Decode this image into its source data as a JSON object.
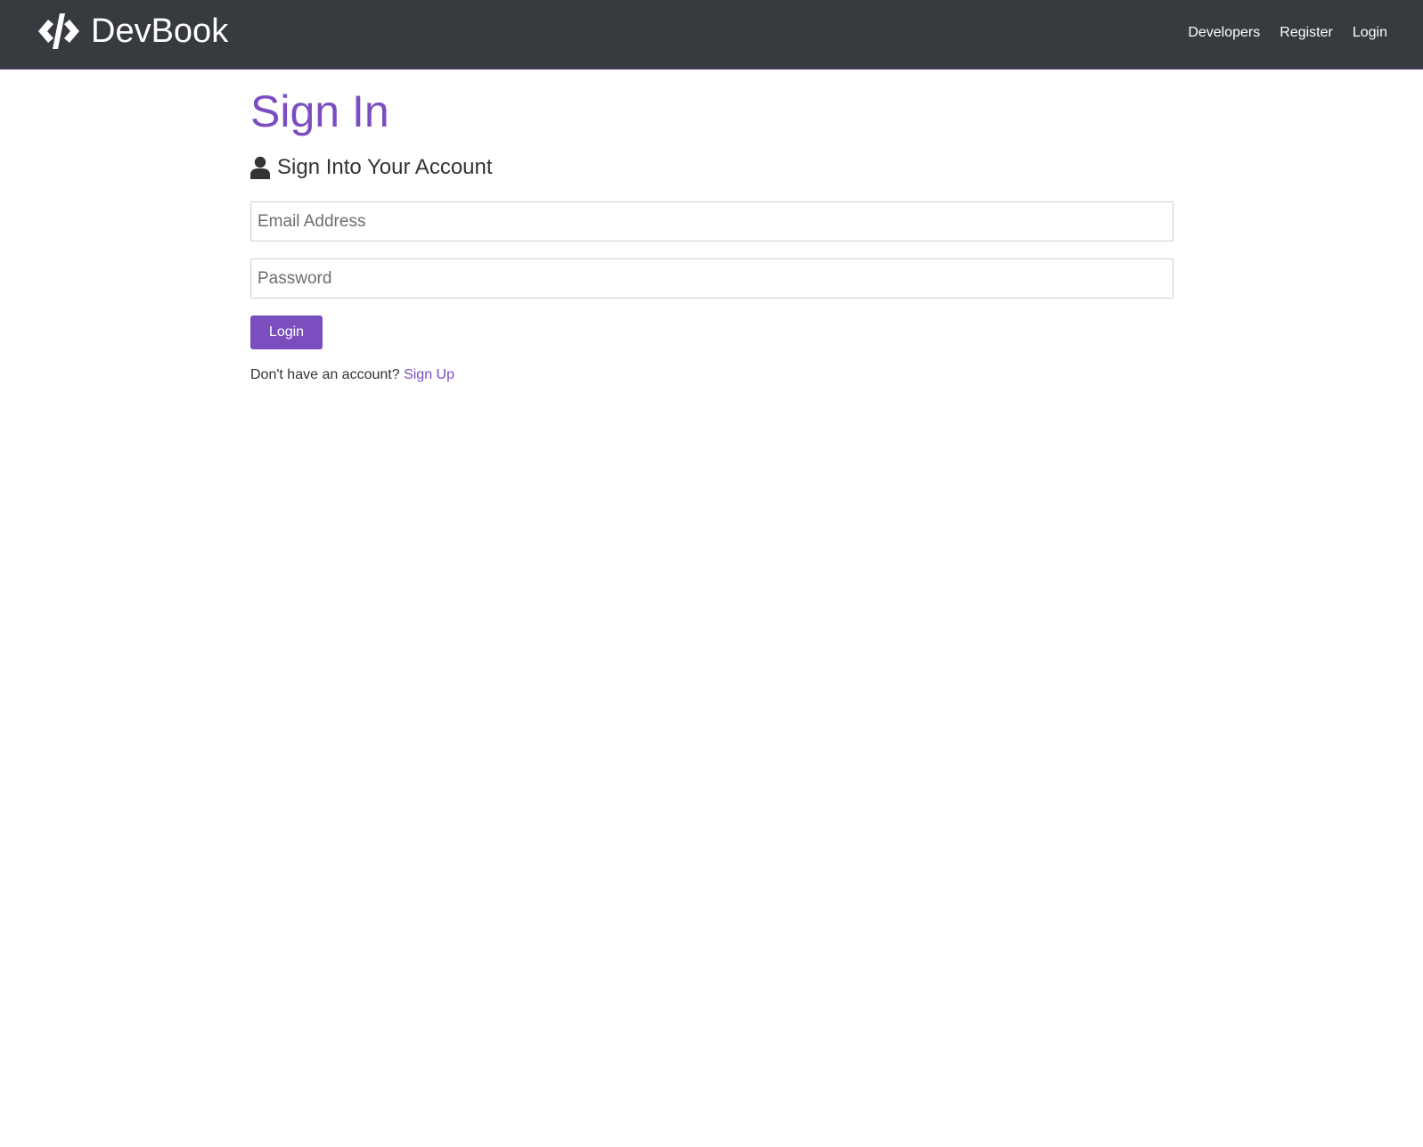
{
  "navbar": {
    "brand_text": "DevBook",
    "brand_icon": "code-icon",
    "links": [
      {
        "label": "Developers"
      },
      {
        "label": "Register"
      },
      {
        "label": "Login"
      }
    ]
  },
  "main": {
    "title": "Sign In",
    "lead_icon": "user-icon",
    "lead_text": "Sign Into Your Account",
    "email_placeholder": "Email Address",
    "email_value": "",
    "password_placeholder": "Password",
    "password_value": "",
    "submit_label": "Login",
    "signup_prompt": "Don't have an account?",
    "signup_link": "Sign Up"
  },
  "colors": {
    "navbar_bg": "#373a3f",
    "accent": "#7b4ec0",
    "text": "#333333"
  }
}
